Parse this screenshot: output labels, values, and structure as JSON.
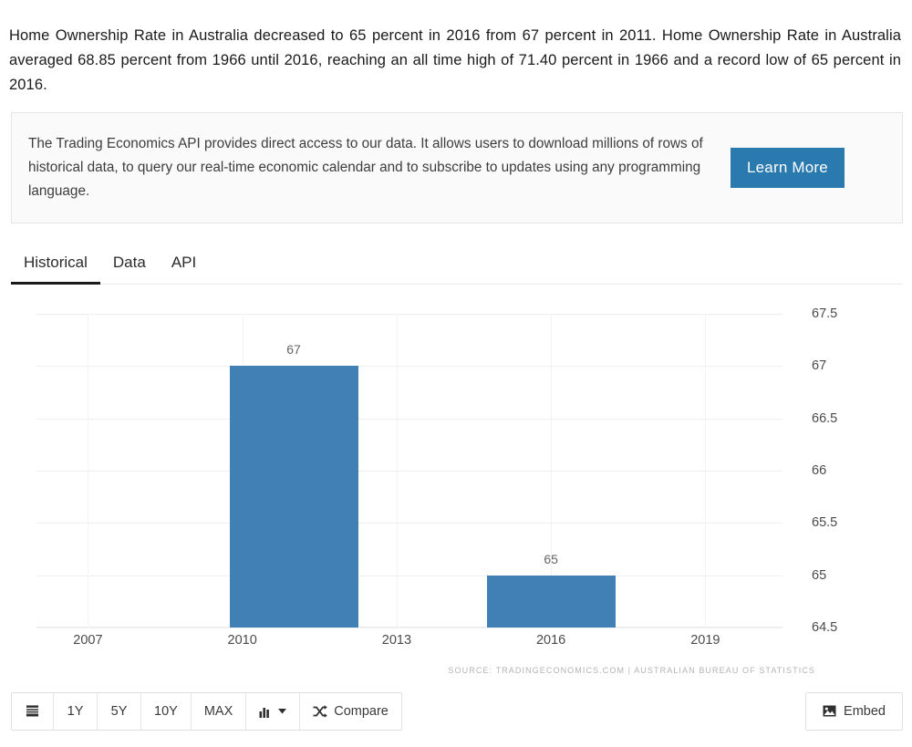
{
  "intro": {
    "paragraph": "Home Ownership Rate in Australia decreased to 65 percent in 2016 from 67 percent in 2011. Home Ownership Rate in Australia averaged 68.85 percent from 1966 until 2016, reaching an all time high of 71.40 percent in 1966 and a record low of 65 percent in 2016."
  },
  "api_banner": {
    "text": "The Trading Economics API provides direct access to our data. It allows users to download millions of rows of historical data, to query our real-time economic calendar and to subscribe to updates using any programming language.",
    "button_label": "Learn More",
    "button_color": "#2a7ab0"
  },
  "tabs": [
    {
      "label": "Historical",
      "active": true
    },
    {
      "label": "Data",
      "active": false
    },
    {
      "label": "API",
      "active": false
    }
  ],
  "chart_data": {
    "type": "bar",
    "title": "",
    "xlabel": "",
    "ylabel": "",
    "categories": [
      2011,
      2016
    ],
    "values": [
      67,
      65
    ],
    "data_labels": [
      "67",
      "65"
    ],
    "bar_color": "#4180b4",
    "ylim": [
      64.5,
      67.5
    ],
    "yticks": [
      67.5,
      67,
      66.5,
      66,
      65.5,
      65,
      64.5
    ],
    "ytick_labels": [
      "67.5",
      "67",
      "66.5",
      "66",
      "65.5",
      "65",
      "64.5"
    ],
    "xlim": [
      2006,
      2020.5
    ],
    "xticks": [
      2007,
      2010,
      2013,
      2016,
      2019
    ],
    "xtick_labels": [
      "2007",
      "2010",
      "2013",
      "2016",
      "2019"
    ],
    "grid": true,
    "legend": "none",
    "source": "SOURCE: TRADINGECONOMICS.COM  |  AUSTRALIAN BUREAU OF STATISTICS"
  },
  "toolbar": {
    "list_icon": "list-icon",
    "ranges": [
      "1Y",
      "5Y",
      "10Y",
      "MAX"
    ],
    "chart_type_icon": "bar-chart-icon",
    "chart_type_caret": "chevron-down-icon",
    "compare_label": "Compare",
    "compare_icon": "shuffle-icon",
    "embed_label": "Embed",
    "embed_icon": "image-icon"
  }
}
